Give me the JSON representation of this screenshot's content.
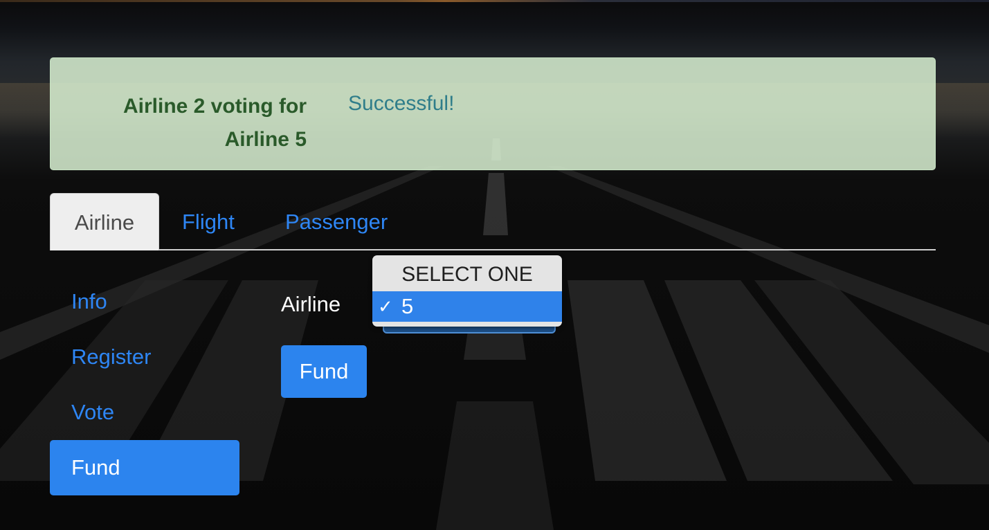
{
  "alert": {
    "label": "Airline 2 voting for Airline 5",
    "message": "Successful!"
  },
  "tabs": [
    {
      "label": "Airline",
      "active": true
    },
    {
      "label": "Flight",
      "active": false
    },
    {
      "label": "Passenger",
      "active": false
    }
  ],
  "sidebar": {
    "items": [
      {
        "label": "Info",
        "active": false
      },
      {
        "label": "Register",
        "active": false
      },
      {
        "label": "Vote",
        "active": false
      },
      {
        "label": "Fund",
        "active": true
      }
    ]
  },
  "form": {
    "airline_label": "Airline",
    "select": {
      "options": [
        "SELECT ONE",
        "5"
      ],
      "selected": "5"
    },
    "submit_label": "Fund"
  },
  "colors": {
    "accent": "#2c84ee",
    "link": "#2e86f5",
    "alert_bg": "#d8f0d2",
    "alert_label": "#2a5a2a",
    "alert_message": "#2f7d8a"
  }
}
